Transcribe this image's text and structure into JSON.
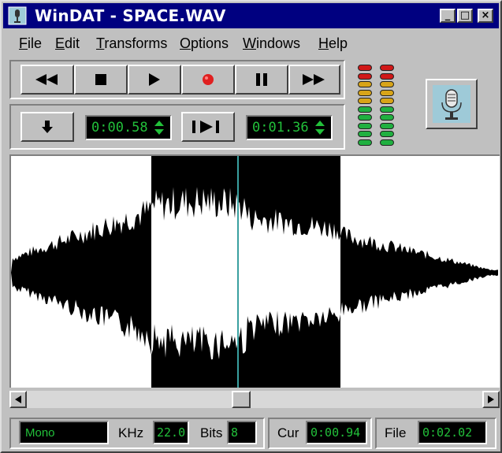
{
  "app": {
    "title": "WinDAT - SPACE.WAV"
  },
  "titlebar": {
    "min_glyph": "_",
    "max_glyph": "□",
    "close_glyph": "×"
  },
  "menu": [
    "File",
    "Edit",
    "Transforms",
    "Options",
    "Windows",
    "Help"
  ],
  "transport": {
    "buttons": [
      "rewind-icon",
      "stop-icon",
      "play-icon",
      "record-icon",
      "pause-icon",
      "fast-forward-icon"
    ],
    "record_color": "#e02020"
  },
  "position": {
    "start_time": "0:00.58",
    "end_time": "0:01.36"
  },
  "meter": {
    "led_colors": [
      "#d01818",
      "#d01818",
      "#d8a418",
      "#d8a418",
      "#d8a418",
      "#20b040",
      "#20b040",
      "#20b040",
      "#20b040",
      "#20b040"
    ]
  },
  "status": {
    "channel": "Mono",
    "khz_label": "KHz",
    "khz_value": "22.0",
    "bits_label": "Bits",
    "bits_value": "8",
    "cur_label": "Cur",
    "cur_value": "0:00.94",
    "file_label": "File",
    "file_value": "0:02.02"
  },
  "colors": {
    "title_bg": "#000080",
    "lcd_text": "#22c03a",
    "cursor_line": "#3aa0a0"
  }
}
